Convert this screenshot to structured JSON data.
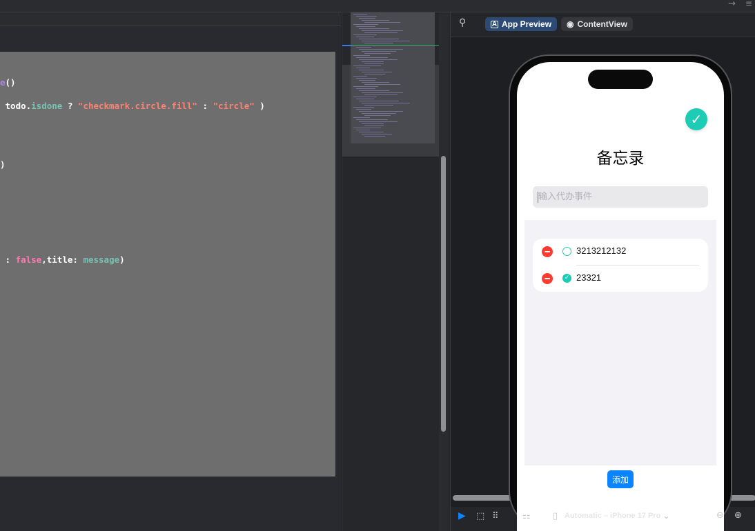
{
  "code_lines": [
    {
      "segments": [
        {
          "t": "e",
          "c": "fn"
        },
        {
          "t": "()",
          "c": ""
        }
      ]
    },
    {
      "segments": [
        {
          "t": " todo.",
          "c": ""
        },
        {
          "t": "isdone",
          "c": "prop"
        },
        {
          "t": " ? ",
          "c": ""
        },
        {
          "t": "\"checkmark.circle.fill\"",
          "c": "str"
        },
        {
          "t": " : ",
          "c": ""
        },
        {
          "t": "\"circle\"",
          "c": "str"
        },
        {
          "t": " )",
          "c": ""
        }
      ]
    },
    {
      "segments": [
        {
          "t": ")",
          "c": ""
        }
      ]
    },
    {
      "segments": [
        {
          "t": " : ",
          "c": ""
        },
        {
          "t": "false",
          "c": "kw"
        },
        {
          "t": ",title: ",
          "c": ""
        },
        {
          "t": "message",
          "c": "prop"
        },
        {
          "t": ")",
          "c": ""
        }
      ]
    }
  ],
  "preview_toolbar": {
    "app_preview_label": "App Preview",
    "content_view_label": "ContentView"
  },
  "app": {
    "title": "备忘录",
    "input_placeholder": "输入代办事件",
    "input_value": "",
    "todos": [
      {
        "title": "3213212132",
        "done": false
      },
      {
        "title": "23321",
        "done": true
      }
    ],
    "add_label": "添加"
  },
  "bottom_bar": {
    "device_label": "Automatic – iPhone 17 Pro"
  },
  "colors": {
    "accent_teal": "#1ecbb5",
    "delete_red": "#ff3b30",
    "add_blue": "#0a84ff"
  }
}
